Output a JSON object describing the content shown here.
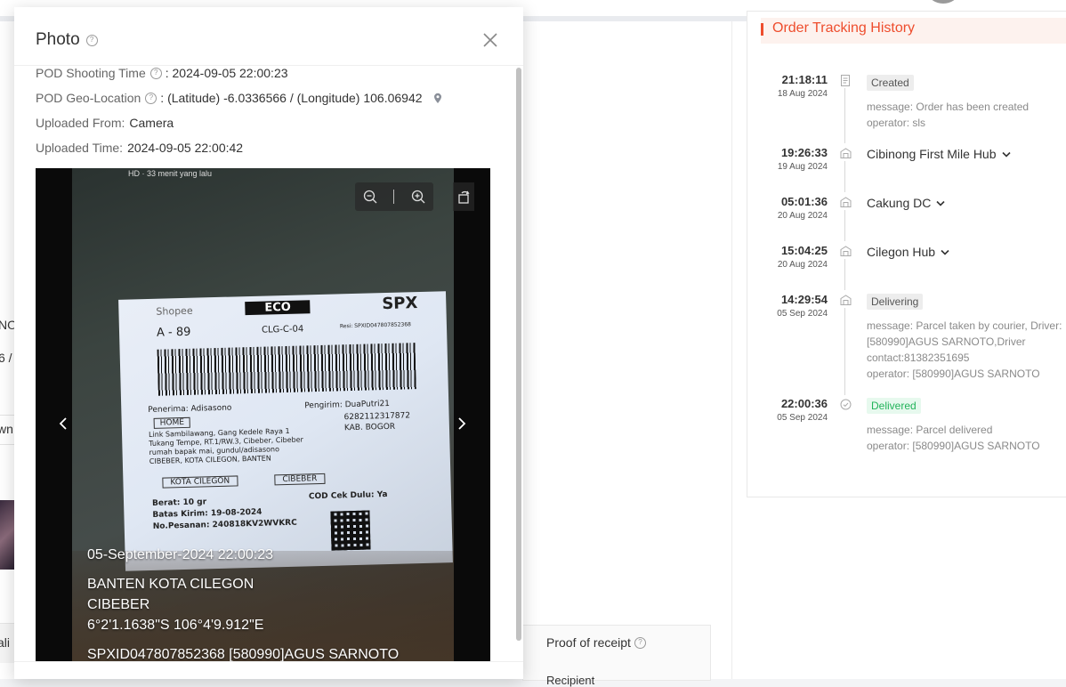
{
  "background": {
    "left_fragments": [
      "NO",
      "6 /",
      "wn",
      "ali"
    ],
    "proof_of_receipt": "Proof of receipt",
    "recipient": "Recipient"
  },
  "modal": {
    "title": "Photo",
    "info": [
      {
        "label": "POD Shooting Time",
        "has_help": true,
        "value": ": 2024-09-05 22:00:23"
      },
      {
        "label": "POD Geo-Location",
        "has_help": true,
        "value": ": (Latitude) -6.0336566 / (Longitude) 106.06942",
        "has_pin": true
      },
      {
        "label": "Uploaded From:",
        "has_help": false,
        "value": "Camera"
      },
      {
        "label": "Uploaded Time:",
        "has_help": false,
        "value": "2024-09-05 22:00:42"
      }
    ],
    "photo": {
      "hd_caption": "HD · 33 menit yang lalu",
      "label_lines": {
        "brand": "Shopee",
        "service": "ECO",
        "carrier": "SPX",
        "sort_code": "A - 89",
        "route": "CLG-C-04",
        "tracking_small": "Resi: SPXID047807852368",
        "recipient": "Penerima: Adisasono",
        "sender": "Pengirim: DuaPutri21",
        "home": "HOME",
        "phone": "628211231787​2",
        "sender_city": "KAB. BOGOR",
        "address1": "Link Sambilawang, Gang Kedele Raya 1",
        "address2": "Tukang Tempe, RT.1/RW.3, Cibeber, Cibeber",
        "address3": "rumah bapak mai, gundul/adisasono",
        "address4": "CIBEBER, KOTA CILEGON, BANTEN",
        "city": "KOTA CILEGON",
        "district": "CIBEBER",
        "weight": "Berat:    10 gr",
        "cod": "COD Cek Dulu: Ya",
        "deadline": "Batas Kirim: 19-08-2024",
        "order_no": "No.Pesanan: 240818KV2WVKRC"
      },
      "overlay": [
        "05-September-2024 22:00:23",
        "BANTEN KOTA CILEGON",
        "CIBEBER",
        "6°2'1.1638\"S 106°4'9.912\"E",
        "SPXID047807852368     [580990]AGUS SARNOTO"
      ]
    }
  },
  "tracking": {
    "title": "Order Tracking History",
    "events": [
      {
        "time": "21:18:11",
        "date": "18 Aug 2024",
        "icon": "document-icon",
        "tag": "Created",
        "tag_style": "gray",
        "messages": [
          "message: Order has been created",
          "operator: sls"
        ]
      },
      {
        "time": "19:26:33",
        "date": "19 Aug 2024",
        "icon": "warehouse-icon",
        "hub": "Cibinong First Mile Hub"
      },
      {
        "time": "05:01:36",
        "date": "20 Aug 2024",
        "icon": "warehouse-icon",
        "hub": "Cakung DC"
      },
      {
        "time": "15:04:25",
        "date": "20 Aug 2024",
        "icon": "warehouse-icon",
        "hub": "Cilegon Hub"
      },
      {
        "time": "14:29:54",
        "date": "05 Sep 2024",
        "icon": "warehouse-icon",
        "tag": "Delivering",
        "tag_style": "gray",
        "messages": [
          "message: Parcel taken by courier, Driver: [580990]AGUS SARNOTO,Driver contact:81382351695",
          "operator: [580990]AGUS SARNOTO"
        ]
      },
      {
        "time": "22:00:36",
        "date": "05 Sep 2024",
        "icon": "check-circle-icon",
        "tag": "Delivered",
        "tag_style": "green",
        "messages": [
          "message: Parcel delivered",
          "operator: [580990]AGUS SARNOTO"
        ]
      }
    ]
  },
  "colors": {
    "accent": "#ee4d2d",
    "delivered_green": "#22b35a"
  }
}
